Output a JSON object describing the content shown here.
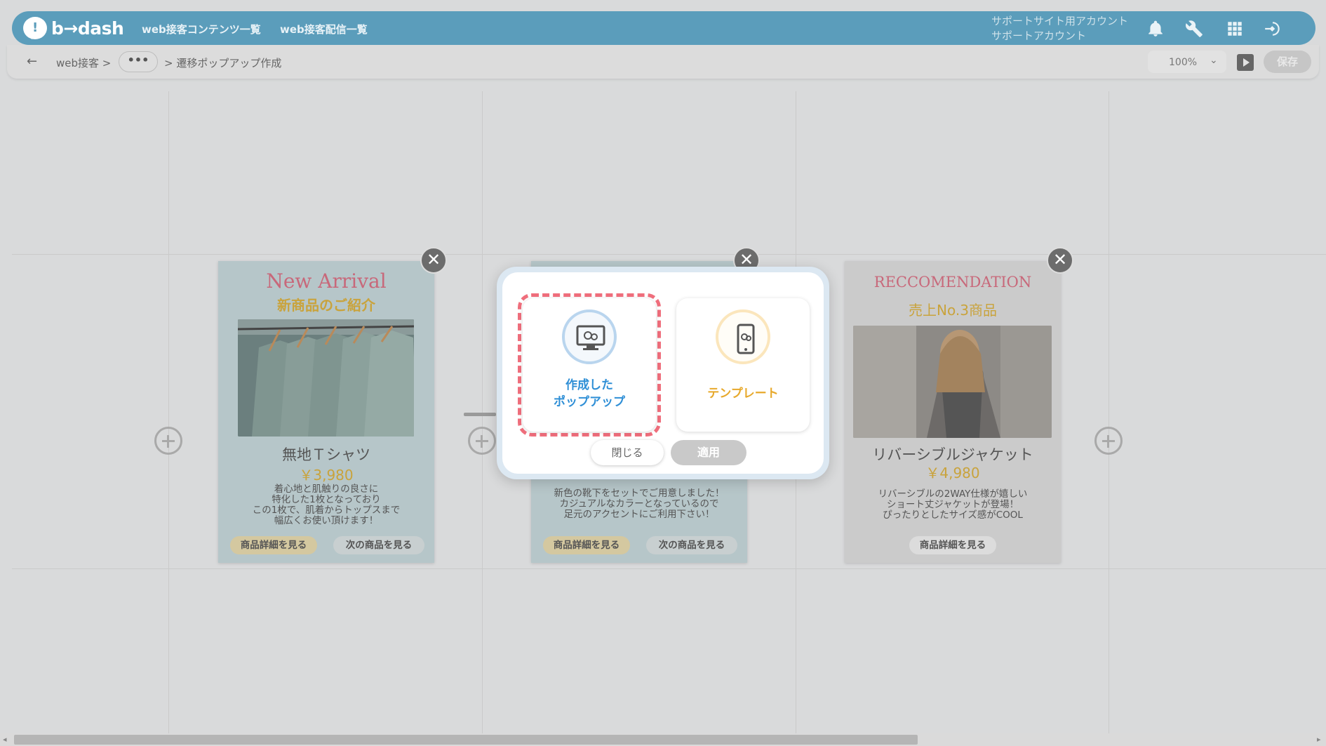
{
  "header": {
    "logo_mark": "!",
    "logo_text": "b→dash",
    "nav": [
      "web接客コンテンツ一覧",
      "web接客配信一覧"
    ],
    "account_line1": "サポートサイト用アカウント",
    "account_line2": "サポートアカウント",
    "icons": [
      "bell-icon",
      "wrench-icon",
      "grid-icon",
      "sign-in-icon"
    ]
  },
  "breadcrumb": {
    "back": "←",
    "item1": "web接客 >",
    "more": "•••",
    "current": "> 遷移ポップアップ作成"
  },
  "toolbar": {
    "zoom": "100%",
    "zoom_caret": "⌄",
    "save": "保存"
  },
  "cards": [
    {
      "title_en": "New Arrival",
      "title_ja": "新商品のご紹介",
      "name": "無地Ｔシャツ",
      "price": "￥3,980",
      "desc": [
        "着心地と肌触りの良さに",
        "特化した1枚となっており",
        "この1枚で、肌着からトップスまで",
        "幅広くお使い頂けます！"
      ],
      "btn_detail": "商品詳細を見る",
      "btn_next": "次の商品を見る"
    },
    {
      "desc": [
        "新色の靴下をセットでご用意しました！",
        "カジュアルなカラーとなっているので",
        "足元のアクセントにご利用下さい！"
      ],
      "btn_detail": "商品詳細を見る",
      "btn_next": "次の商品を見る"
    },
    {
      "title_en": "RECCOMENDATION",
      "title_ja": "売上No.3商品",
      "name": "リバーシブルジャケット",
      "price": "￥4,980",
      "desc": [
        "リバーシブルの2WAY仕様が嬉しい",
        "ショート丈ジャケットが登場！",
        "ぴったりとしたサイズ感がCOOL"
      ],
      "btn_detail": "商品詳細を見る"
    }
  ],
  "close_glyph": "✕",
  "modal": {
    "option1_line1": "作成した",
    "option1_line2": "ポップアップ",
    "option2": "テンプレート",
    "close": "閉じる",
    "apply": "適用"
  },
  "scrollbar": {
    "left": "◂",
    "right": "▸"
  },
  "colors": {
    "header": "#5b9dbb",
    "accent_blue": "#2f8fd6",
    "accent_gold": "#e7a92c",
    "selection_dash": "#ef6e7c"
  }
}
